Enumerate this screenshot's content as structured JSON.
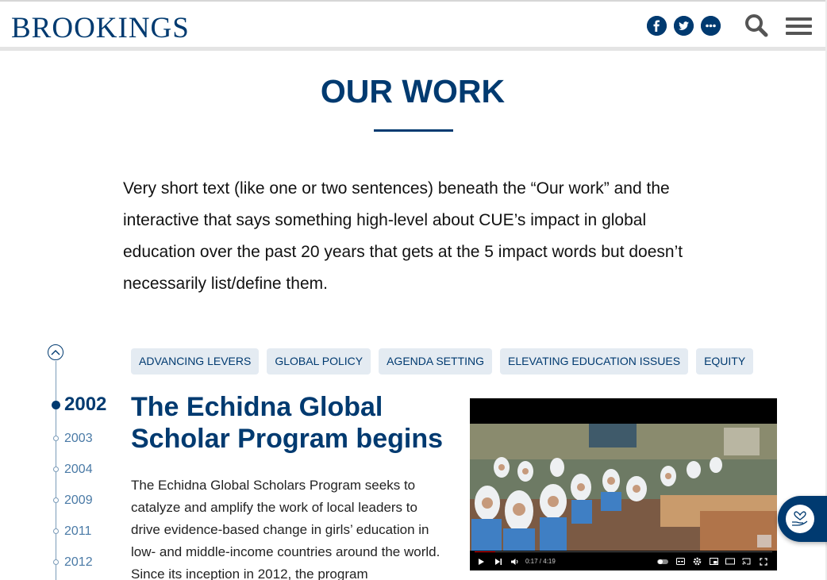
{
  "header": {
    "logo": "BROOKINGS",
    "social": [
      {
        "icon": "facebook-icon",
        "glyph": "f"
      },
      {
        "icon": "twitter-icon",
        "glyph": ""
      },
      {
        "icon": "more-icon",
        "glyph": "•••"
      }
    ]
  },
  "section": {
    "title": "OUR WORK",
    "intro": "Very short text (like one or two sentences) beneath the “Our work” and the interactive that says something high-level about CUE’s impact in global education over the past 20 years that gets at the 5 impact words but doesn’t necessarily list/define them."
  },
  "timeline": {
    "years": [
      "2002",
      "2003",
      "2004",
      "2009",
      "2011",
      "2012"
    ],
    "active": "2002"
  },
  "tags": [
    "ADVANCING LEVERS",
    "GLOBAL POLICY",
    "AGENDA SETTING",
    "ELEVATING EDUCATION ISSUES",
    "EQUITY"
  ],
  "item": {
    "title": "The Echidna Global Scholar Program begins",
    "body": "The Echidna Global Scholars Program seeks to catalyze and amplify the work of local leaders to drive evidence-based change in girls’ education in low- and middle-income countries around the world. Since its inception in 2012, the program"
  },
  "video": {
    "time": "0:17 / 4:19",
    "progress": 0.07
  },
  "colors": {
    "brand": "#003a70",
    "tag_bg": "#e4ebf2",
    "progress": "#ee0000"
  }
}
